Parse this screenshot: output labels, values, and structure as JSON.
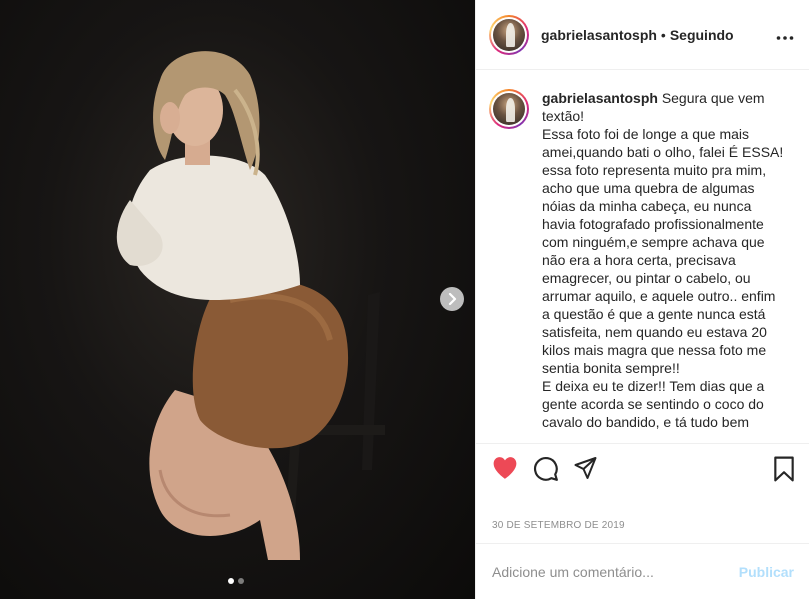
{
  "post": {
    "username": "gabrielasantosph",
    "separator": "•",
    "follow_status": "Seguindo",
    "more_icon": "more-horizontal-icon"
  },
  "caption": {
    "username": "gabrielasantosph",
    "text": "Segura que vem textão!\nEssa foto foi de longe a que mais amei,quando bati o olho, falei É ESSA! essa foto representa muito pra mim, acho que uma quebra de algumas nóias da minha cabeça, eu nunca havia fotografado profissionalmente com ninguém,e sempre achava que não era a hora certa, precisava emagrecer, ou pintar o cabelo, ou arrumar aquilo, e aquele outro.. enfim a questão é que a gente nunca está satisfeita, nem quando eu estava 20 kilos mais magra que nessa foto me sentia bonita sempre!!\nE deixa eu te dizer!! Tem dias que a gente acorda se sentindo o coco do cavalo do bandido, e tá tudo bem"
  },
  "actions": {
    "like_icon": "heart-icon",
    "like_color": "#ed4956",
    "comment_icon": "comment-icon",
    "share_icon": "share-icon",
    "save_icon": "bookmark-icon"
  },
  "date": "30 DE SETEMBRO DE 2019",
  "comment": {
    "placeholder": "Adicione um comentário...",
    "publish_label": "Publicar",
    "publish_color": "#b2dffc"
  },
  "carousel": {
    "next_icon": "chevron-right-icon",
    "current": 1,
    "total": 2
  }
}
